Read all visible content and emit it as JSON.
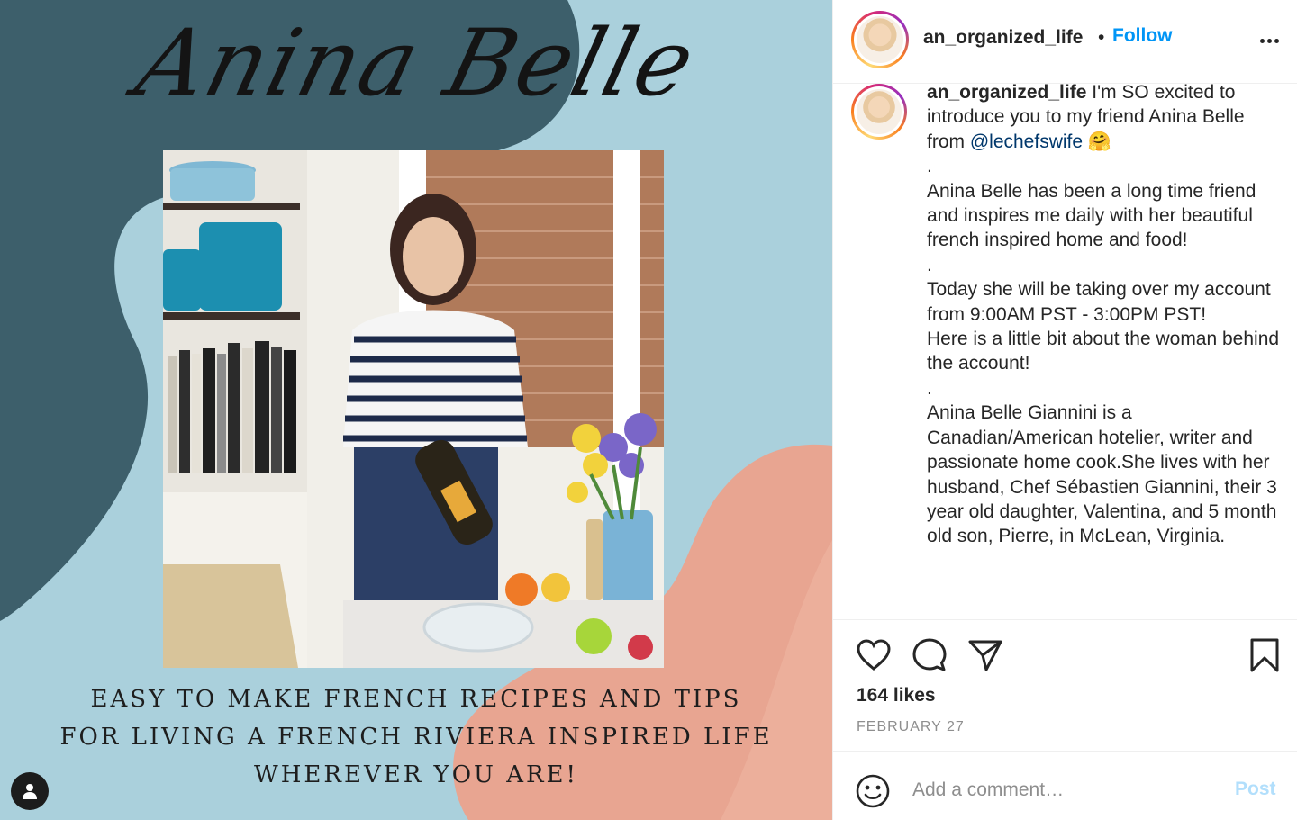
{
  "post_image": {
    "script_title": "Anina Belle",
    "caption_lines": [
      "EASY TO MAKE FRENCH RECIPES AND TIPS",
      "FOR LIVING A FRENCH RIVIERA INSPIRED LIFE",
      "WHEREVER YOU ARE!"
    ],
    "colors": {
      "dark_teal": "#3d5f6b",
      "light_blue": "#aad0dc",
      "peach": "#e8a591",
      "salmon": "#efb5a2"
    },
    "user_tag_icon": "user-icon"
  },
  "header": {
    "username": "an_organized_life",
    "separator": "•",
    "follow_label": "Follow",
    "more_icon": "more-horizontal-icon"
  },
  "caption": {
    "username": "an_organized_life",
    "intro": "I'm SO excited to introduce you to my friend Anina Belle from",
    "mention": "@lechefswife",
    "emoji": "🤗",
    "paragraphs": [
      ".",
      "Anina Belle has been a long time friend and inspires me daily with her beautiful french inspired home and food!",
      ".",
      "Today she will be taking over my account from 9:00AM PST - 3:00PM PST!",
      "Here is a little bit about the woman behind the account!",
      ".",
      "Anina Belle Giannini is a Canadian/American hotelier, writer and passionate home cook.She lives with her husband, Chef Sébastien Giannini, their 3 year old daughter, Valentina, and 5 month old son, Pierre, in McLean, Virginia."
    ]
  },
  "actions": {
    "like_icon": "heart-icon",
    "comment_icon": "comment-icon",
    "share_icon": "share-icon",
    "save_icon": "bookmark-icon",
    "likes_text": "164 likes",
    "date_text": "FEBRUARY 27"
  },
  "comment_bar": {
    "emoji_icon": "emoji-icon",
    "placeholder": "Add a comment…",
    "post_label": "Post"
  }
}
